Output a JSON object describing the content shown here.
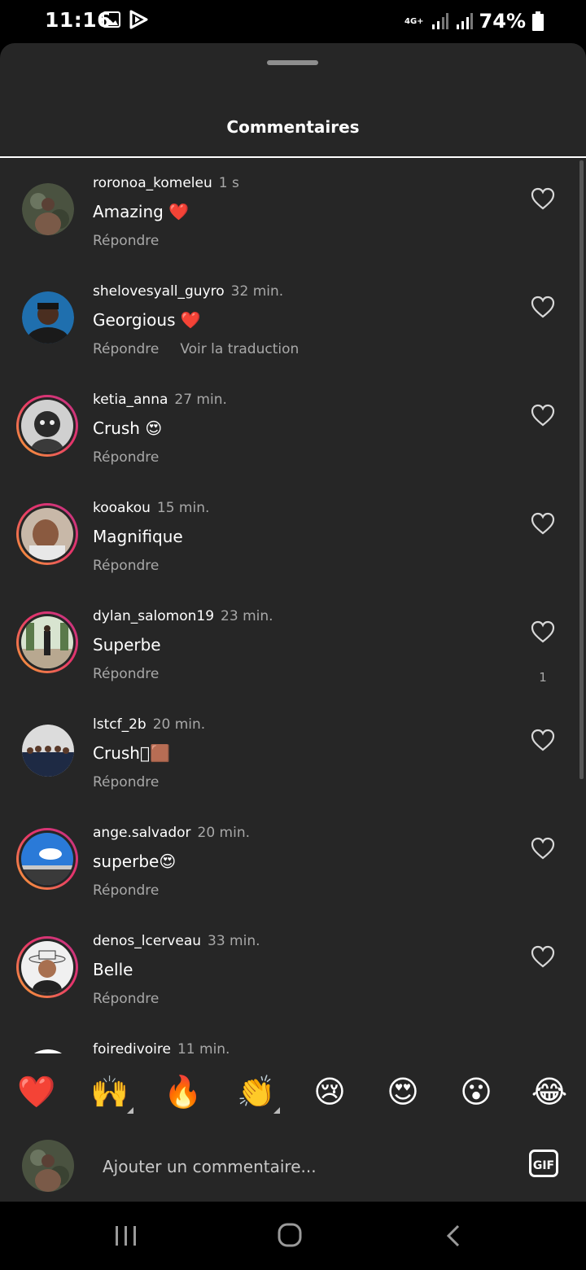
{
  "status_bar": {
    "time": "11:16",
    "network": "4G+",
    "battery": "74%"
  },
  "sheet": {
    "title": "Commentaires"
  },
  "comments": [
    {
      "user": "roronoa_komeleu",
      "time": "1 s",
      "text": "Amazing ❤️",
      "reply": "Répondre",
      "translate": "",
      "likes": "",
      "story": false
    },
    {
      "user": "shelovesyall_guyro",
      "time": "32 min.",
      "text": "Georgious ❤️",
      "reply": "Répondre",
      "translate": "Voir la traduction",
      "likes": "",
      "story": false
    },
    {
      "user": "ketia_anna",
      "time": "27 min.",
      "text": "Crush 😍",
      "reply": "Répondre",
      "translate": "",
      "likes": "",
      "story": true
    },
    {
      "user": "kooakou",
      "time": "15 min.",
      "text": "Magnifique",
      "reply": "Répondre",
      "translate": "",
      "likes": "",
      "story": true
    },
    {
      "user": "dylan_salomon19",
      "time": "23 min.",
      "text": "Superbe",
      "reply": "Répondre",
      "translate": "",
      "likes": "1",
      "story": true
    },
    {
      "user": "lstcf_2b",
      "time": "20 min.",
      "text": "Crush🏾🟫",
      "reply": "Répondre",
      "translate": "",
      "likes": "",
      "story": false
    },
    {
      "user": "ange.salvador",
      "time": "20 min.",
      "text": "superbe😍",
      "reply": "Répondre",
      "translate": "",
      "likes": "",
      "story": true
    },
    {
      "user": "denos_lcerveau",
      "time": "33 min.",
      "text": "Belle",
      "reply": "Répondre",
      "translate": "",
      "likes": "",
      "story": true
    },
    {
      "user": "foiredivoire",
      "time": "11 min.",
      "text": "",
      "reply": "",
      "translate": "",
      "likes": "",
      "story": false
    }
  ],
  "reactions": [
    "❤️",
    "🙌",
    "🔥",
    "👏",
    "😢",
    "😍",
    "😮",
    "😂"
  ],
  "input": {
    "placeholder": "Ajouter un commentaire...",
    "gif_label": "GIF"
  },
  "colors": {
    "sheet_bg": "#262626",
    "secondary_text": "#a8a8a8",
    "story_ring_start": "#f7a534",
    "story_ring_end": "#c13584"
  }
}
